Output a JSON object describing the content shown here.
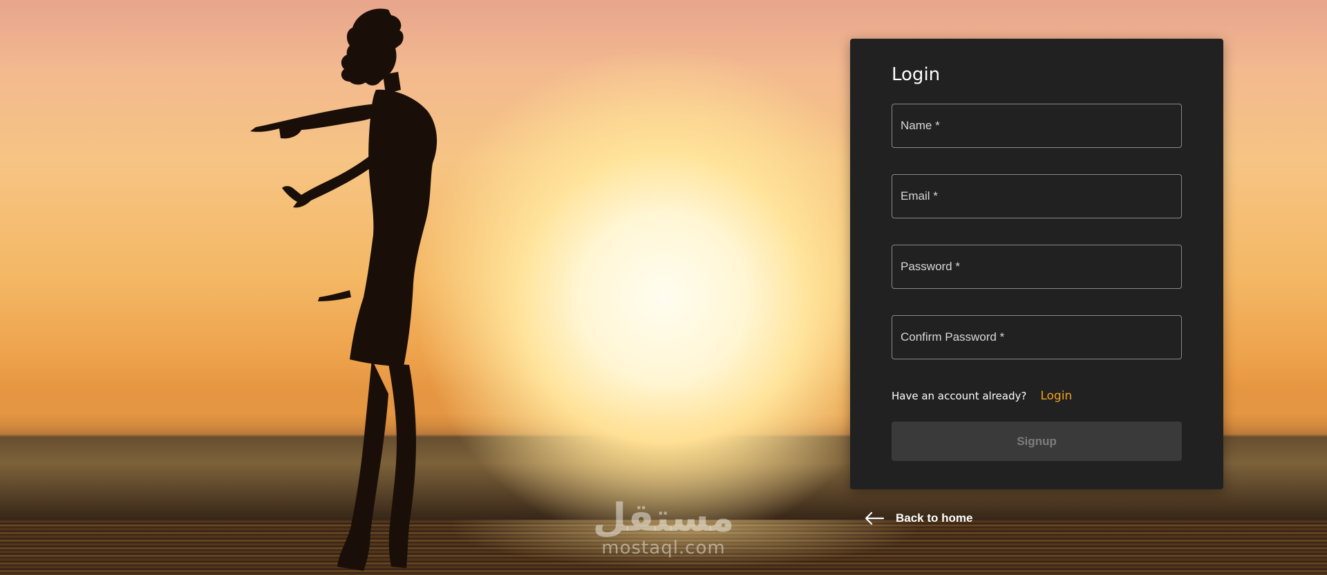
{
  "background": {
    "description_icon": "sunset-silhouette-image"
  },
  "watermark": {
    "arabic": "مستقل",
    "latin": "mostaql.com"
  },
  "form": {
    "title": "Login",
    "fields": [
      {
        "label": "Name *",
        "type": "text"
      },
      {
        "label": "Email *",
        "type": "email"
      },
      {
        "label": "Password *",
        "type": "password"
      },
      {
        "label": "Confirm Password *",
        "type": "password"
      }
    ],
    "account_prompt": "Have an account already?",
    "login_link": "Login",
    "submit_label": "Signup"
  },
  "nav": {
    "back_icon": "arrow-left-icon",
    "back_label": "Back to home"
  },
  "colors": {
    "card_bg": "#212121",
    "accent": "#f5a11c",
    "button_disabled_bg": "#3a3a3a",
    "button_disabled_text": "#7d7d7d"
  }
}
